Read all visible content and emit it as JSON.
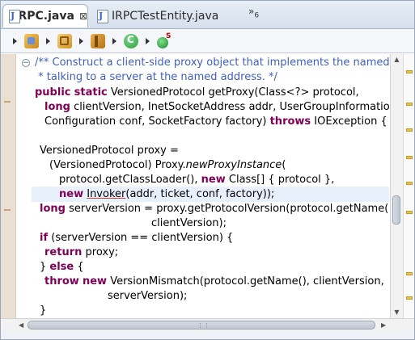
{
  "tabs": [
    {
      "label": "RPC.java",
      "close": "⊠",
      "active": true
    },
    {
      "label": "IRPCTestEntity.java",
      "active": false
    }
  ],
  "overflow": {
    "glyph": "»",
    "count": "6"
  },
  "breadcrumb": {
    "icons": [
      "package-folder-icon",
      "package-icon",
      "jar-package-icon",
      "class-icon",
      "static-method-icon"
    ],
    "static_marker": "S"
  },
  "editor": {
    "fold_glyph": "−",
    "lines": {
      "l1": "/** Construct a client-side proxy object that implements the named proto",
      "l2": " * talking to a server at the named address. */",
      "l3_kw1": "public",
      "l3_kw2": "static",
      "l3_rest": " VersionedProtocol getProxy(Class<?> protocol,",
      "l4_kw": "long",
      "l4_rest": " clientVersion, InetSocketAddress addr, UserGroupInformation tick",
      "l5_pre": "Configuration conf, SocketFactory factory) ",
      "l5_kw": "throws",
      "l5_rest": " IOException {",
      "l7": "VersionedProtocol proxy =",
      "l8_pre": "(VersionedProtocol) Proxy.",
      "l8_it": "newProxyInstance",
      "l8_rest": "(",
      "l9_pre": "protocol.getClassLoader(), ",
      "l9_kw": "new",
      "l9_rest": " Class[] { protocol },",
      "l10_kw": "new",
      "l10_sp": " ",
      "l10_u": "Invoker",
      "l10_rest": "(addr, ticket, conf, factory));",
      "l11_kw": "long",
      "l11_rest": " serverVersion = proxy.getProtocolVersion(protocol.getName(),",
      "l12": "clientVersion);",
      "l13_kw": "if",
      "l13_rest": " (serverVersion == clientVersion) {",
      "l14_kw": "return",
      "l14_rest": " proxy;",
      "l15_pre": "} ",
      "l15_kw": "else",
      "l15_rest": " {",
      "l16_kw1": "throw",
      "l16_kw2": "new",
      "l16_rest": " VersionMismatch(protocol.getName(), clientVersion,",
      "l17": "serverVersion);",
      "l18": "}"
    }
  },
  "scroll": {
    "up": "▲",
    "down": "▼",
    "left": "◀",
    "right": "▶",
    "grip": "⋮⋮"
  },
  "colors": {
    "keyword": "#7f0055",
    "javadoc": "#3f5fbf",
    "highlight": "#e8f0fb"
  }
}
